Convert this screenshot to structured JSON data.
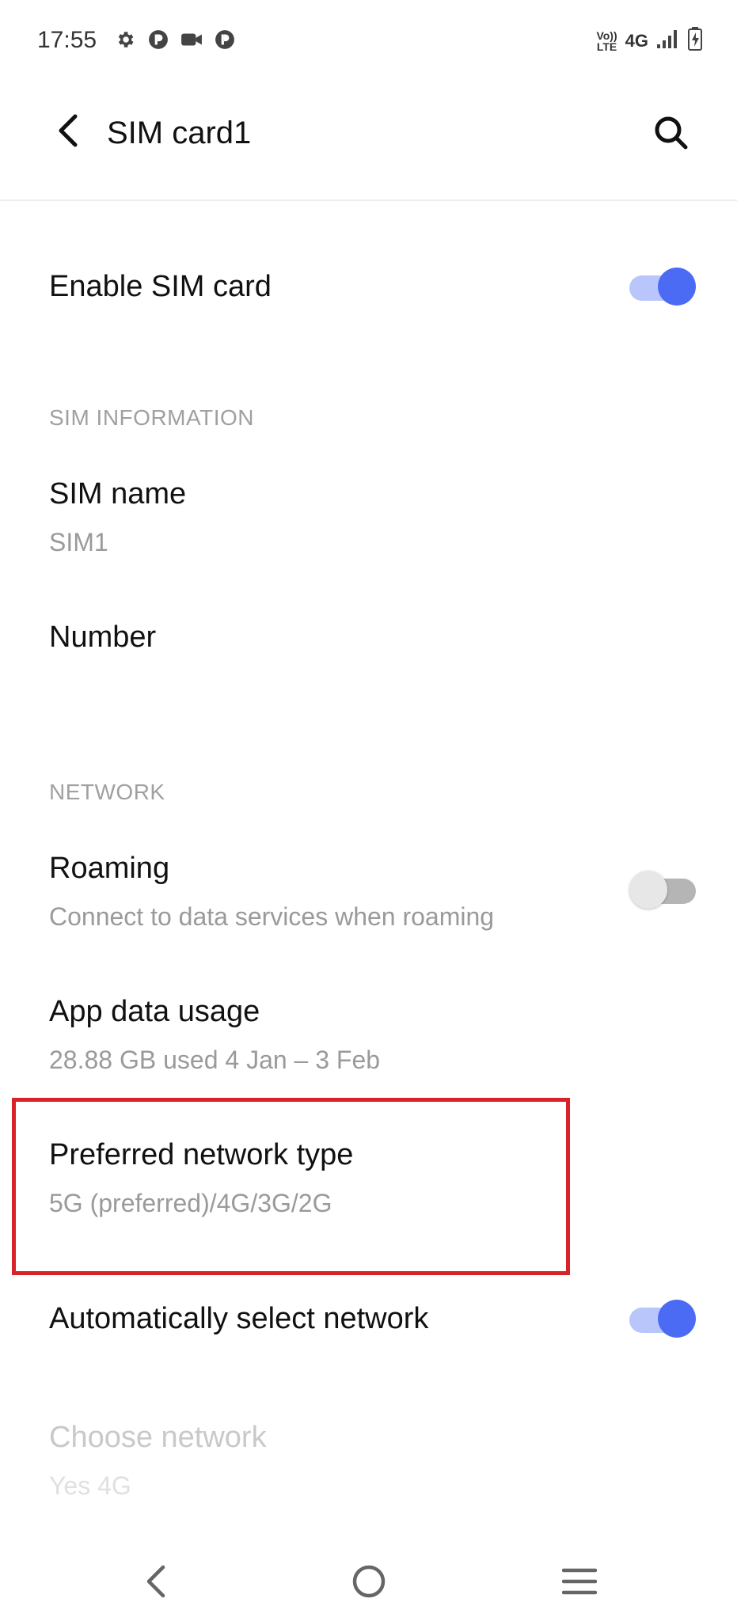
{
  "status_bar": {
    "time": "17:55",
    "left_icons": [
      "gear-icon",
      "p-circle-icon",
      "video-icon",
      "p-circle-icon"
    ],
    "volte_top": "Vo))",
    "volte_bottom": "LTE",
    "network": "4G",
    "signal_icon": "signal-icon",
    "battery_icon": "battery-charging-icon"
  },
  "header": {
    "title": "SIM card1",
    "back_icon": "back-arrow-icon",
    "search_icon": "search-icon"
  },
  "enable_sim": {
    "label": "Enable SIM card",
    "state": true
  },
  "sim_info": {
    "section_label": "SIM INFORMATION",
    "sim_name_label": "SIM name",
    "sim_name_value": "SIM1",
    "number_label": "Number"
  },
  "network": {
    "section_label": "NETWORK",
    "roaming": {
      "label": "Roaming",
      "description": "Connect to data services when roaming",
      "state": false
    },
    "app_data": {
      "label": "App data usage",
      "value": "28.88 GB used 4 Jan – 3 Feb"
    },
    "preferred": {
      "label": "Preferred network type",
      "value": "5G (preferred)/4G/3G/2G"
    },
    "auto_select": {
      "label": "Automatically select network",
      "state": true
    },
    "choose": {
      "label": "Choose network",
      "value": "Yes 4G",
      "disabled": true
    }
  },
  "colors": {
    "accent": "#4b6bf5",
    "highlight": "#d8232a"
  },
  "nav_bar": {
    "back_icon": "nav-back-icon",
    "home_icon": "nav-home-icon",
    "menu_icon": "nav-menu-icon"
  }
}
